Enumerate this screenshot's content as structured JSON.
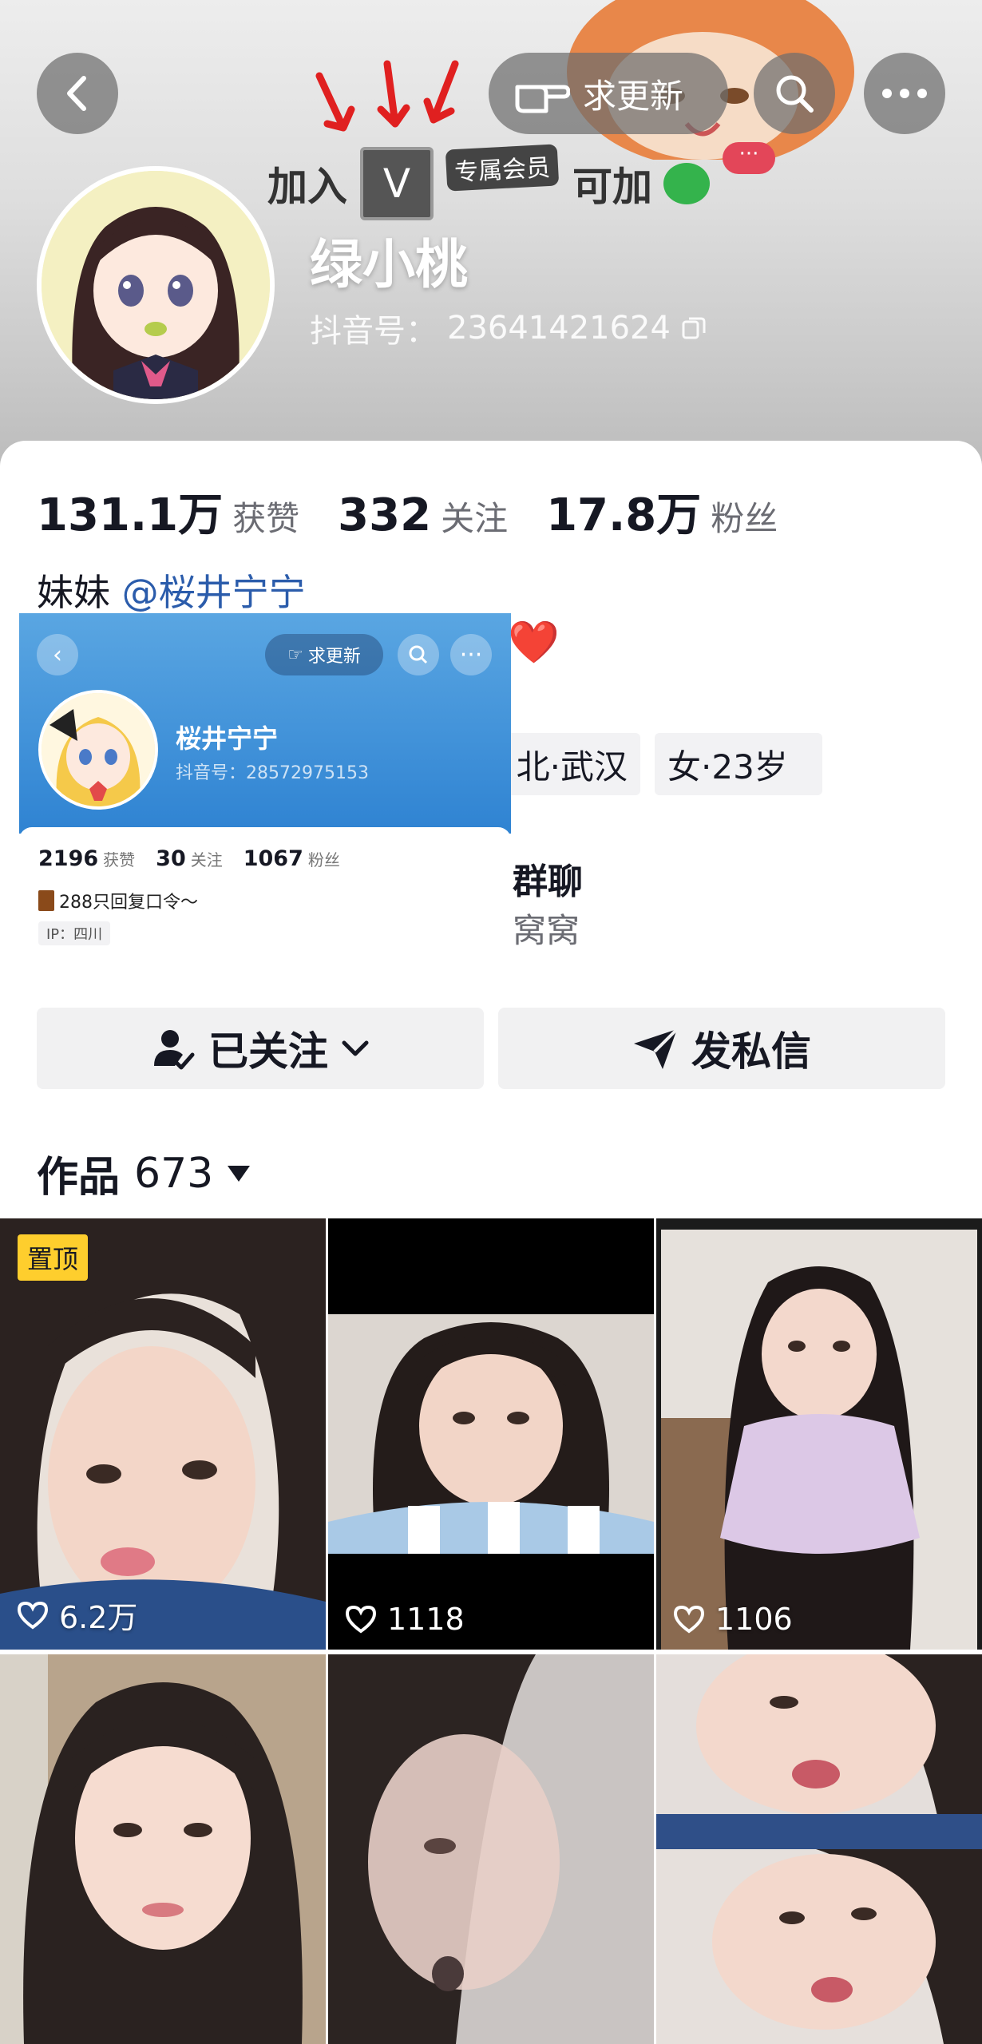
{
  "header": {
    "request_update_label": "求更新",
    "join_text": "加入",
    "member_text": "专属会员",
    "can_add_text": "可加",
    "chat_dots": "···"
  },
  "profile": {
    "nickname": "绿小桃",
    "uid_label": "抖音号：",
    "uid": "23641421624",
    "stats": {
      "likes_value": "131.1万",
      "likes_label": "获赞",
      "following_value": "332",
      "following_label": "关注",
      "fans_value": "17.8万",
      "fans_label": "粉丝"
    },
    "bio_prefix": "妹妹",
    "bio_mention": "@桜井宁宁",
    "heart": "❤️",
    "tags": [
      "北·武汉",
      "女·23岁"
    ],
    "group": {
      "title": "群聊",
      "subtitle": "窝窝"
    }
  },
  "overlay": {
    "request_update_label": "求更新",
    "nickname": "桜井宁宁",
    "uid_label": "抖音号：",
    "uid": "28572975153",
    "likes_value": "2196",
    "likes_label": "获赞",
    "following_value": "30",
    "following_label": "关注",
    "fans_value": "1067",
    "fans_label": "粉丝",
    "bio": "288只回复口令～",
    "ip": "IP：四川"
  },
  "actions": {
    "followed_label": "已关注",
    "message_label": "发私信"
  },
  "works": {
    "label": "作品",
    "count": "673",
    "pinned_label": "置顶",
    "items": [
      {
        "likes": "6.2万"
      },
      {
        "likes": "1118"
      },
      {
        "likes": "1106"
      },
      {
        "likes": ""
      },
      {
        "likes": ""
      },
      {
        "likes": ""
      }
    ]
  },
  "colors": {
    "accent_mention": "#2b5cab",
    "pin_badge": "#fece2d",
    "heart": "#e8202b",
    "overlay_blue": "#2f83d2"
  }
}
